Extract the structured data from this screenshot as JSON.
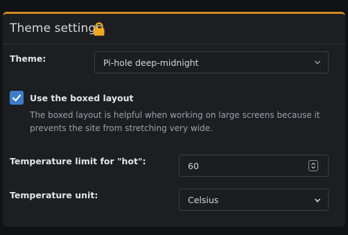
{
  "panel": {
    "title": "Theme settings",
    "accent_color": "#d28a1e",
    "lock_icon": "lock-icon"
  },
  "theme": {
    "label": "Theme:",
    "selected": "Pi-hole deep-midnight"
  },
  "boxed_layout": {
    "label": "Use the boxed layout",
    "checked": true,
    "help": "The boxed layout is helpful when working on large screens because it prevents the site from stretching very wide."
  },
  "temperature_limit": {
    "label": "Temperature limit for \"hot\":",
    "value": "60"
  },
  "temperature_unit": {
    "label": "Temperature unit:",
    "selected": "Celsius"
  }
}
